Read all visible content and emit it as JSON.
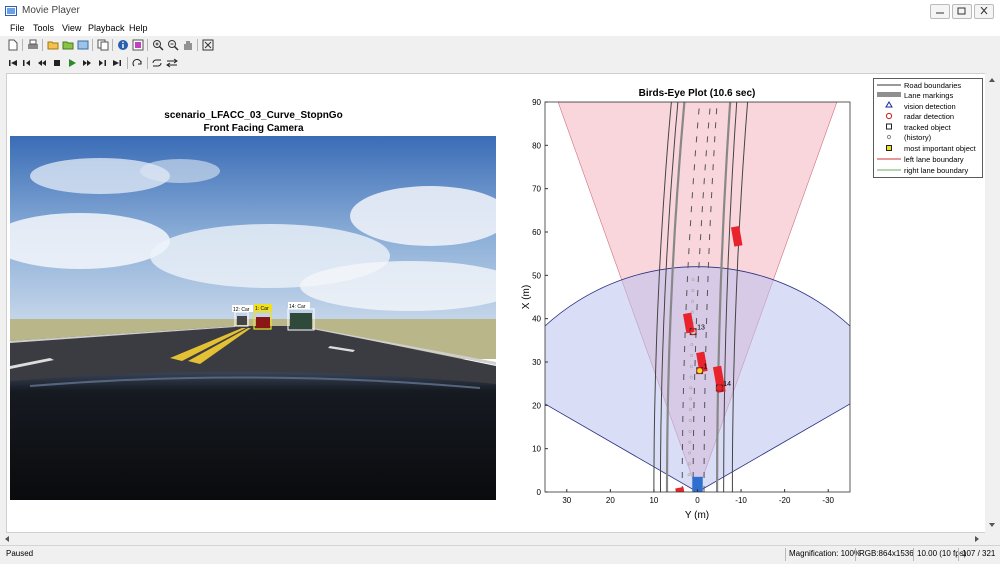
{
  "window": {
    "title": "Movie Player"
  },
  "menu": [
    "File",
    "Tools",
    "View",
    "Playback",
    "Help"
  ],
  "video": {
    "title_line1": "scenario_LFACC_03_Curve_StopnGo",
    "title_line2": "Front Facing Camera",
    "labels": [
      "12: Car",
      "1: Car",
      "14: Car"
    ]
  },
  "chart_data": {
    "type": "scatter",
    "title": "Birds-Eye Plot (10.6 sec)",
    "xlabel": "Y (m)",
    "ylabel": "X (m)",
    "xlim": [
      35,
      -35
    ],
    "ylim": [
      0,
      90
    ],
    "xticks": [
      30,
      20,
      10,
      0,
      -10,
      -20,
      -30
    ],
    "yticks": [
      0,
      10,
      20,
      30,
      40,
      50,
      60,
      70,
      80,
      90
    ],
    "legend_position": "top-right",
    "legend": [
      "Road boundaries",
      "Lane markings",
      "vision detection",
      "radar detection",
      "tracked object",
      "(history)",
      "most important object",
      "left lane boundary",
      "right lane boundary"
    ],
    "track_labels": [
      {
        "label": "13",
        "y": 1,
        "x": 37
      },
      {
        "label": "1",
        "y": -0.5,
        "x": 28
      },
      {
        "label": "14",
        "y": -5,
        "x": 24
      }
    ],
    "vehicles": [
      {
        "y": -9,
        "x": 59,
        "len": 4.5
      },
      {
        "y": 2,
        "x": 39,
        "len": 4.5
      },
      {
        "y": -1,
        "x": 30,
        "len": 4.5
      },
      {
        "y": -5,
        "x": 26,
        "len": 6
      },
      {
        "y": 4,
        "x": 0,
        "len": 2
      }
    ],
    "colors": {
      "radar_coverage": "#f3b5be",
      "vision_coverage": "#b9c1ee",
      "vehicle": "#e8232b",
      "ego": "#2f6fd0"
    }
  },
  "status": {
    "state": "Paused",
    "magnification": "Magnification: 100%",
    "format": "RGB:864x1536",
    "fps": "10.00 (10 fps)",
    "frame": "107 / 321"
  }
}
